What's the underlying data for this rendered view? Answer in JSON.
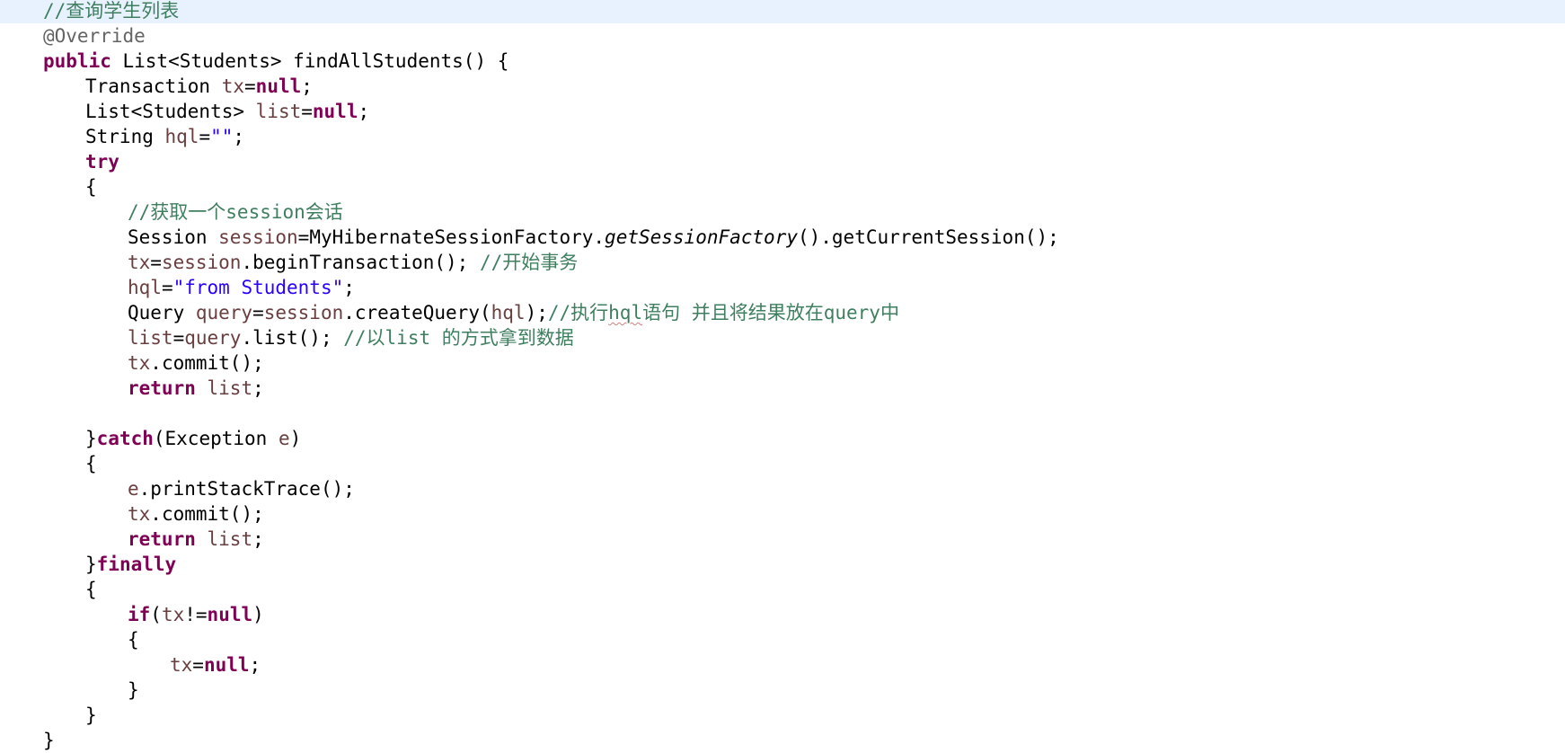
{
  "editor": {
    "colors": {
      "keyword": "#7f0055",
      "local_variable": "#6a3e3e",
      "string": "#2a00ff",
      "comment": "#3f7f5f",
      "annotation": "#646464",
      "current_line_highlight": "#e8f2fe"
    },
    "lines": [
      {
        "indent": 0,
        "current": true,
        "tokens": [
          {
            "t": "//查询学生列表",
            "c": "cmt"
          }
        ]
      },
      {
        "indent": 0,
        "tokens": [
          {
            "t": "@Override",
            "c": "ann"
          }
        ]
      },
      {
        "indent": 0,
        "tokens": [
          {
            "t": "public",
            "c": "kw"
          },
          {
            "t": " List<Students> findAllStudents() {"
          }
        ]
      },
      {
        "indent": 1,
        "tokens": [
          {
            "t": "Transaction "
          },
          {
            "t": "tx",
            "c": "var"
          },
          {
            "t": "="
          },
          {
            "t": "null",
            "c": "kw"
          },
          {
            "t": ";"
          }
        ]
      },
      {
        "indent": 1,
        "tokens": [
          {
            "t": "List<Students> "
          },
          {
            "t": "list",
            "c": "var"
          },
          {
            "t": "="
          },
          {
            "t": "null",
            "c": "kw"
          },
          {
            "t": ";"
          }
        ]
      },
      {
        "indent": 1,
        "tokens": [
          {
            "t": "String "
          },
          {
            "t": "hql",
            "c": "var"
          },
          {
            "t": "="
          },
          {
            "t": "\"\"",
            "c": "str"
          },
          {
            "t": ";"
          }
        ]
      },
      {
        "indent": 1,
        "tokens": [
          {
            "t": "try",
            "c": "kw"
          }
        ]
      },
      {
        "indent": 1,
        "tokens": [
          {
            "t": "{"
          }
        ]
      },
      {
        "indent": 2,
        "tokens": [
          {
            "t": "//获取一个session会话",
            "c": "cmt"
          }
        ]
      },
      {
        "indent": 2,
        "tokens": [
          {
            "t": "Session "
          },
          {
            "t": "session",
            "c": "var"
          },
          {
            "t": "=MyHibernateSessionFactory."
          },
          {
            "t": "getSessionFactory",
            "c": "ital"
          },
          {
            "t": "().getCurrentSession();"
          }
        ]
      },
      {
        "indent": 2,
        "tokens": [
          {
            "t": "tx",
            "c": "var"
          },
          {
            "t": "="
          },
          {
            "t": "session",
            "c": "var"
          },
          {
            "t": ".beginTransaction(); "
          },
          {
            "t": "//开始事务",
            "c": "cmt"
          }
        ]
      },
      {
        "indent": 2,
        "tokens": [
          {
            "t": "hql",
            "c": "var"
          },
          {
            "t": "="
          },
          {
            "t": "\"from Students\"",
            "c": "str"
          },
          {
            "t": ";"
          }
        ]
      },
      {
        "indent": 2,
        "tokens": [
          {
            "t": "Query "
          },
          {
            "t": "query",
            "c": "var"
          },
          {
            "t": "="
          },
          {
            "t": "session",
            "c": "var"
          },
          {
            "t": ".createQuery("
          },
          {
            "t": "hql",
            "c": "var"
          },
          {
            "t": ");"
          },
          {
            "t": "//执行",
            "c": "cmt"
          },
          {
            "t": "hql",
            "c": "cmt squig"
          },
          {
            "t": "语句 并且将结果放在query中",
            "c": "cmt"
          }
        ]
      },
      {
        "indent": 2,
        "tokens": [
          {
            "t": "list",
            "c": "var"
          },
          {
            "t": "="
          },
          {
            "t": "query",
            "c": "var"
          },
          {
            "t": ".list(); "
          },
          {
            "t": "//以list 的方式拿到数据",
            "c": "cmt"
          }
        ]
      },
      {
        "indent": 2,
        "tokens": [
          {
            "t": "tx",
            "c": "var"
          },
          {
            "t": ".commit();"
          }
        ]
      },
      {
        "indent": 2,
        "tokens": [
          {
            "t": "return",
            "c": "kw"
          },
          {
            "t": " "
          },
          {
            "t": "list",
            "c": "var"
          },
          {
            "t": ";"
          }
        ]
      },
      {
        "indent": 0,
        "tokens": []
      },
      {
        "indent": 1,
        "tokens": [
          {
            "t": "}"
          },
          {
            "t": "catch",
            "c": "kw"
          },
          {
            "t": "(Exception "
          },
          {
            "t": "e",
            "c": "var"
          },
          {
            "t": ")"
          }
        ]
      },
      {
        "indent": 1,
        "tokens": [
          {
            "t": "{"
          }
        ]
      },
      {
        "indent": 2,
        "tokens": [
          {
            "t": "e",
            "c": "var"
          },
          {
            "t": ".printStackTrace();"
          }
        ]
      },
      {
        "indent": 2,
        "tokens": [
          {
            "t": "tx",
            "c": "var"
          },
          {
            "t": ".commit();"
          }
        ]
      },
      {
        "indent": 2,
        "tokens": [
          {
            "t": "return",
            "c": "kw"
          },
          {
            "t": " "
          },
          {
            "t": "list",
            "c": "var"
          },
          {
            "t": ";"
          }
        ]
      },
      {
        "indent": 1,
        "tokens": [
          {
            "t": "}"
          },
          {
            "t": "finally",
            "c": "kw"
          }
        ]
      },
      {
        "indent": 1,
        "tokens": [
          {
            "t": "{"
          }
        ]
      },
      {
        "indent": 2,
        "tokens": [
          {
            "t": "if",
            "c": "kw"
          },
          {
            "t": "("
          },
          {
            "t": "tx",
            "c": "var"
          },
          {
            "t": "!="
          },
          {
            "t": "null",
            "c": "kw"
          },
          {
            "t": ")"
          }
        ]
      },
      {
        "indent": 2,
        "tokens": [
          {
            "t": "{"
          }
        ]
      },
      {
        "indent": 3,
        "tokens": [
          {
            "t": "tx",
            "c": "var"
          },
          {
            "t": "="
          },
          {
            "t": "null",
            "c": "kw"
          },
          {
            "t": ";"
          }
        ]
      },
      {
        "indent": 2,
        "tokens": [
          {
            "t": "}"
          }
        ]
      },
      {
        "indent": 1,
        "tokens": [
          {
            "t": "}"
          }
        ]
      },
      {
        "indent": 0,
        "tokens": [
          {
            "t": "}"
          }
        ]
      }
    ]
  }
}
